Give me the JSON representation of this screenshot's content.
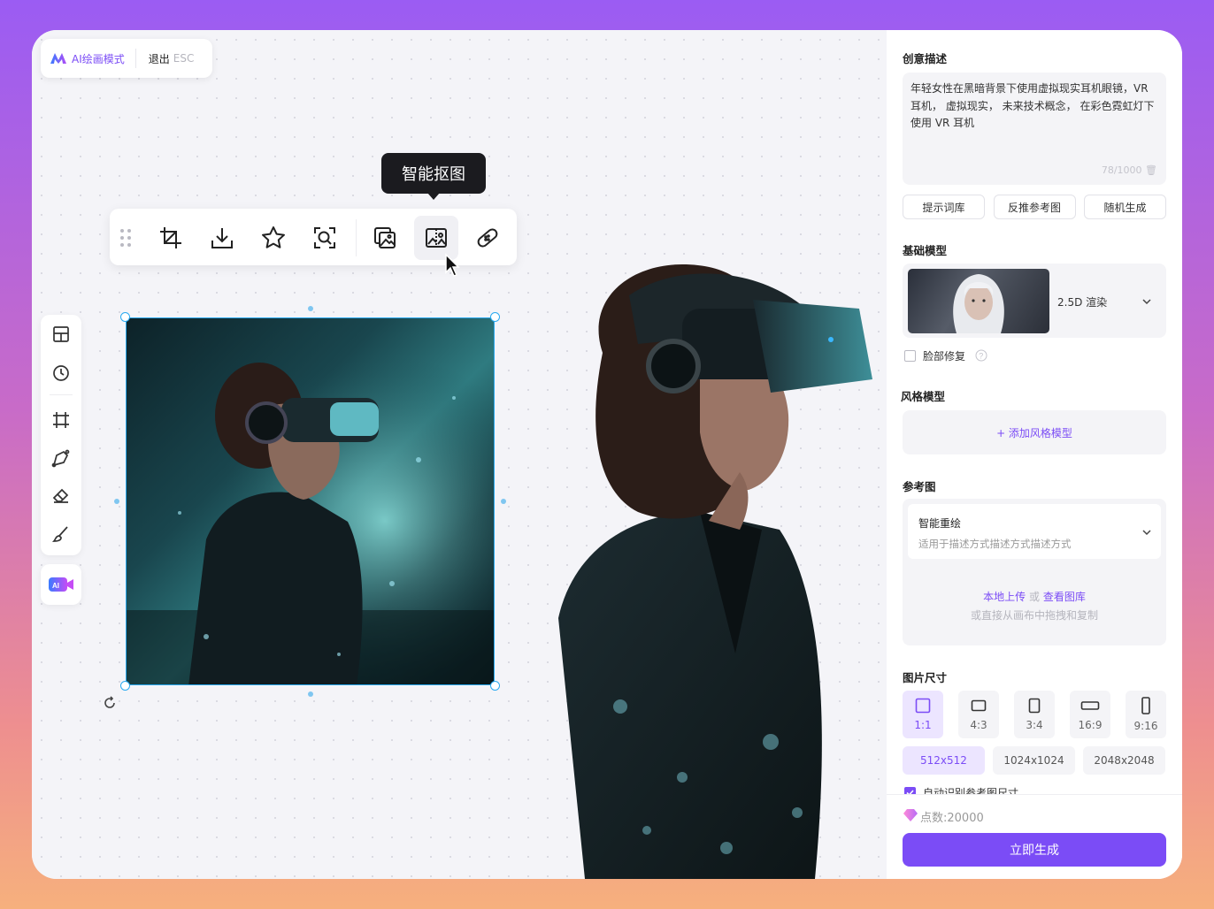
{
  "modebar": {
    "mode_label": "AI绘画模式",
    "exit_label": "退出",
    "exit_key": "ESC"
  },
  "tooltip": {
    "text": "智能抠图"
  },
  "toolbar": {
    "tools": [
      {
        "name": "crop-icon"
      },
      {
        "name": "download-icon"
      },
      {
        "name": "star-icon"
      },
      {
        "name": "zoom-scan-icon"
      },
      {
        "name": "image-copy-icon"
      },
      {
        "name": "smart-cutout-icon"
      },
      {
        "name": "bandage-repair-icon"
      }
    ]
  },
  "sidetools": [
    {
      "name": "layout-grid-icon"
    },
    {
      "name": "history-clock-icon"
    },
    {
      "name": "frame-crop-icon"
    },
    {
      "name": "pen-tool-icon"
    },
    {
      "name": "eraser-icon"
    },
    {
      "name": "brush-icon"
    }
  ],
  "panel": {
    "prompt_title": "创意描述",
    "prompt_text": "年轻女性在黑暗背景下使用虚拟现实耳机眼镜，VR 耳机， 虚拟现实， 未来技术概念， 在彩色霓虹灯下使用 VR 耳机",
    "prompt_counter": "78/1000",
    "buttons": {
      "library": "提示词库",
      "reverse": "反推参考图",
      "random": "随机生成"
    },
    "base_model_title": "基础模型",
    "base_model_name": "2.5D 渲染",
    "face_fix_label": "脸部修复",
    "style_model_title": "风格模型",
    "add_style_label": "+ 添加风格模型",
    "reference_title": "参考图",
    "reference_mode": "智能重绘",
    "reference_desc": "适用于描述方式描述方式描述方式",
    "upload_local": "本地上传",
    "upload_or": "或",
    "upload_gallery": "查看图库",
    "upload_hint": "或直接从画布中拖拽和复制",
    "size_title": "图片尺寸",
    "ratios": [
      "1:1",
      "4:3",
      "3:4",
      "16:9",
      "9:16"
    ],
    "resolutions": [
      "512x512",
      "1024x1024",
      "2048x2048"
    ],
    "auto_detect_label": "自动识别参考图尺寸",
    "points_label": "点数:20000",
    "generate_label": "立即生成"
  },
  "colors": {
    "accent": "#7b4cf6",
    "selection": "#28a9f0"
  }
}
